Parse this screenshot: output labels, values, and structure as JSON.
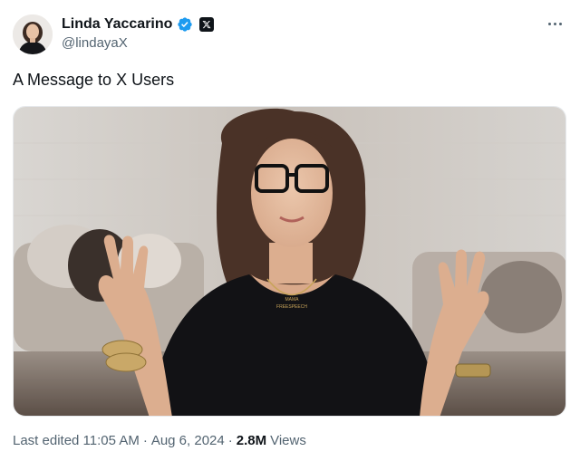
{
  "author": {
    "name": "Linda Yaccarino",
    "handle": "@lindayaX",
    "verified": true,
    "verified_color": "#1d9bf0",
    "affiliate_badge": "x-logo-icon",
    "avatar": "profile-photo"
  },
  "tweet": {
    "text": "A Message to X Users",
    "media": {
      "type": "video-still",
      "necklace_text_top": "MAMA",
      "necklace_text_bottom": "FREESPEECH"
    }
  },
  "meta": {
    "last_edited_label": "Last edited 11:05 AM",
    "separator": "·",
    "date": "Aug 6, 2024",
    "views_count": "2.8M",
    "views_label": "Views"
  },
  "colors": {
    "text_primary": "#0f1419",
    "text_secondary": "#536471"
  },
  "icons": {
    "more": "more-horizontal-icon"
  }
}
